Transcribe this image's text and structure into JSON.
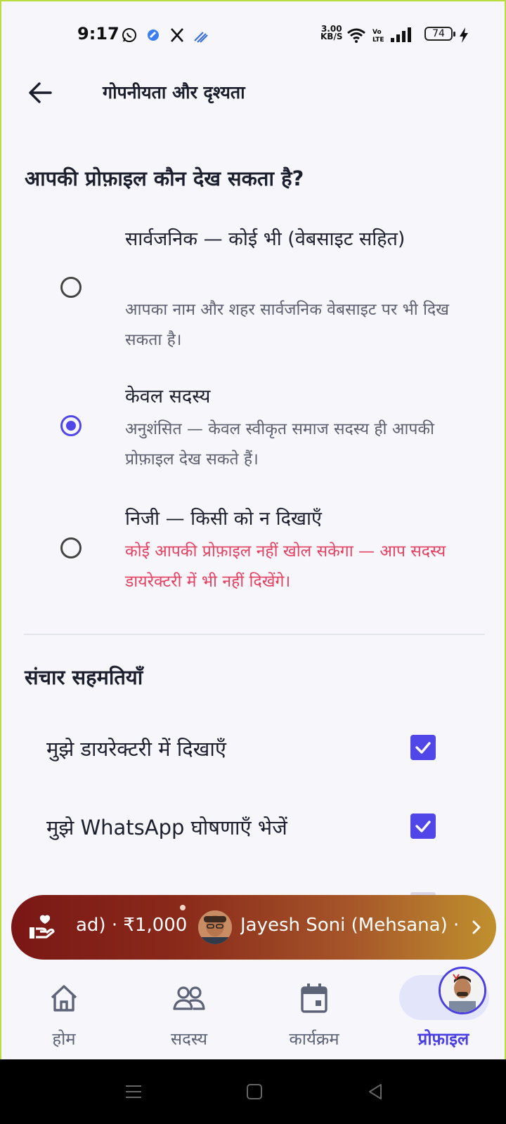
{
  "status_bar": {
    "time": "9:17",
    "net_speed_value": "3.00",
    "net_speed_unit": "KB/S",
    "battery": "74"
  },
  "header": {
    "title": "गोपनीयता और दृश्यता"
  },
  "visibility": {
    "heading": "आपकी प्रोफ़ाइल कौन देख सकता है?",
    "options": [
      {
        "title": "सार्वजनिक — कोई भी (वेबसाइट सहित)",
        "description": "आपका नाम और शहर सार्वजनिक वेबसाइट पर भी दिख सकता है।",
        "selected": false
      },
      {
        "title": "केवल सदस्य",
        "description": "अनुशंसित — केवल स्वीकृत समाज सदस्य ही आपकी प्रोफ़ाइल देख सकते हैं।",
        "selected": true
      },
      {
        "title": "निजी — किसी को न दिखाएँ",
        "description": "कोई आपकी प्रोफ़ाइल नहीं खोल सकेगा — आप सदस्य डायरेक्टरी में भी नहीं दिखेंगे।",
        "selected": false
      }
    ]
  },
  "communication": {
    "heading": "संचार सहमतियाँ",
    "items": [
      {
        "label": "मुझे डायरेक्टरी में दिखाएँ",
        "checked": true
      },
      {
        "label": "मुझे WhatsApp घोषणाएँ भेजें",
        "checked": true
      }
    ]
  },
  "banner": {
    "text_left": "ad) · ₹1,000",
    "text_right": "Jayesh Soni (Mehsana) · ₹"
  },
  "bottom_nav": {
    "items": [
      {
        "label": "होम",
        "icon": "home-icon",
        "active": false
      },
      {
        "label": "सदस्य",
        "icon": "members-icon",
        "active": false
      },
      {
        "label": "कार्यक्रम",
        "icon": "calendar-icon",
        "active": false
      },
      {
        "label": "प्रोफ़ाइल",
        "icon": "profile-avatar",
        "active": true
      }
    ]
  },
  "colors": {
    "accent": "#5147e8",
    "warning_text": "#e44262",
    "frame_border": "#b9dc3f"
  }
}
